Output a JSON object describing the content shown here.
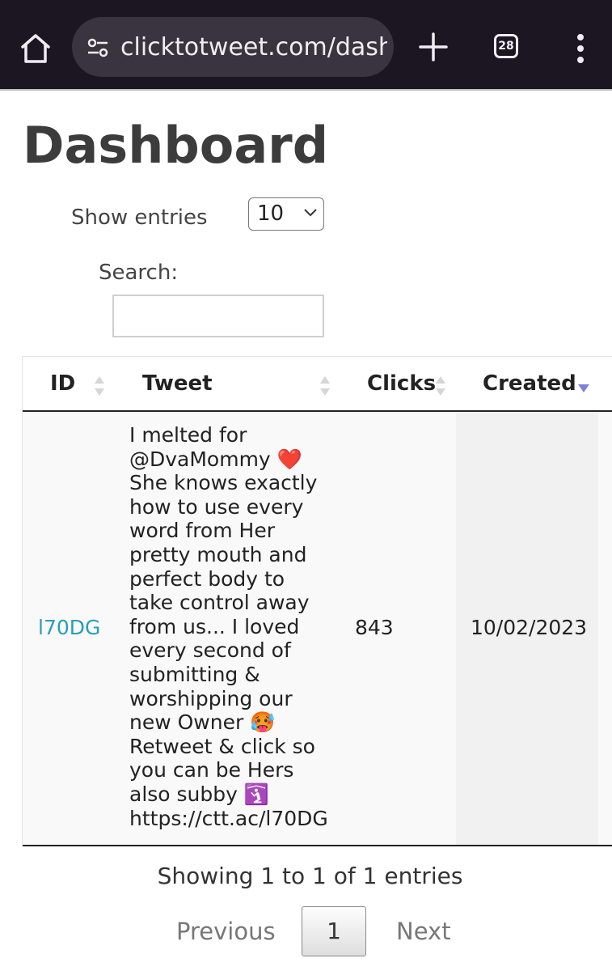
{
  "browser": {
    "url": "clicktotweet.com/dashboard",
    "tab_count": "28"
  },
  "page": {
    "title": "Dashboard"
  },
  "controls": {
    "show_entries_label": "Show entries",
    "entries_value": "10",
    "search_label": "Search:",
    "search_value": ""
  },
  "table": {
    "headers": [
      "ID",
      "Tweet",
      "Clicks",
      "Created"
    ],
    "sorted_column": "Created",
    "sort_direction": "descending",
    "rows": [
      {
        "id": "l70DG",
        "tweet": "I melted for\n@DvaMommy ❤️\nShe knows exactly\nhow to use every\nword from Her\npretty mouth and\nperfect body to\ntake control away\nfrom us... I loved\nevery second of\nsubmitting &\nworshipping our\nnew Owner 🥵\nRetweet & click so\nyou can be Hers\nalso subby 🛐\nhttps://ctt.ac/l70DG",
        "clicks": "843",
        "created": "10/02/2023"
      }
    ]
  },
  "footer": {
    "info": "Showing 1 to 1 of 1 entries",
    "previous_label": "Previous",
    "current_page": "1",
    "next_label": "Next"
  },
  "colors": {
    "top_bar": "#1b1621",
    "link": "#2a9dbb",
    "sort_arrow_active": "#7b83d6"
  }
}
